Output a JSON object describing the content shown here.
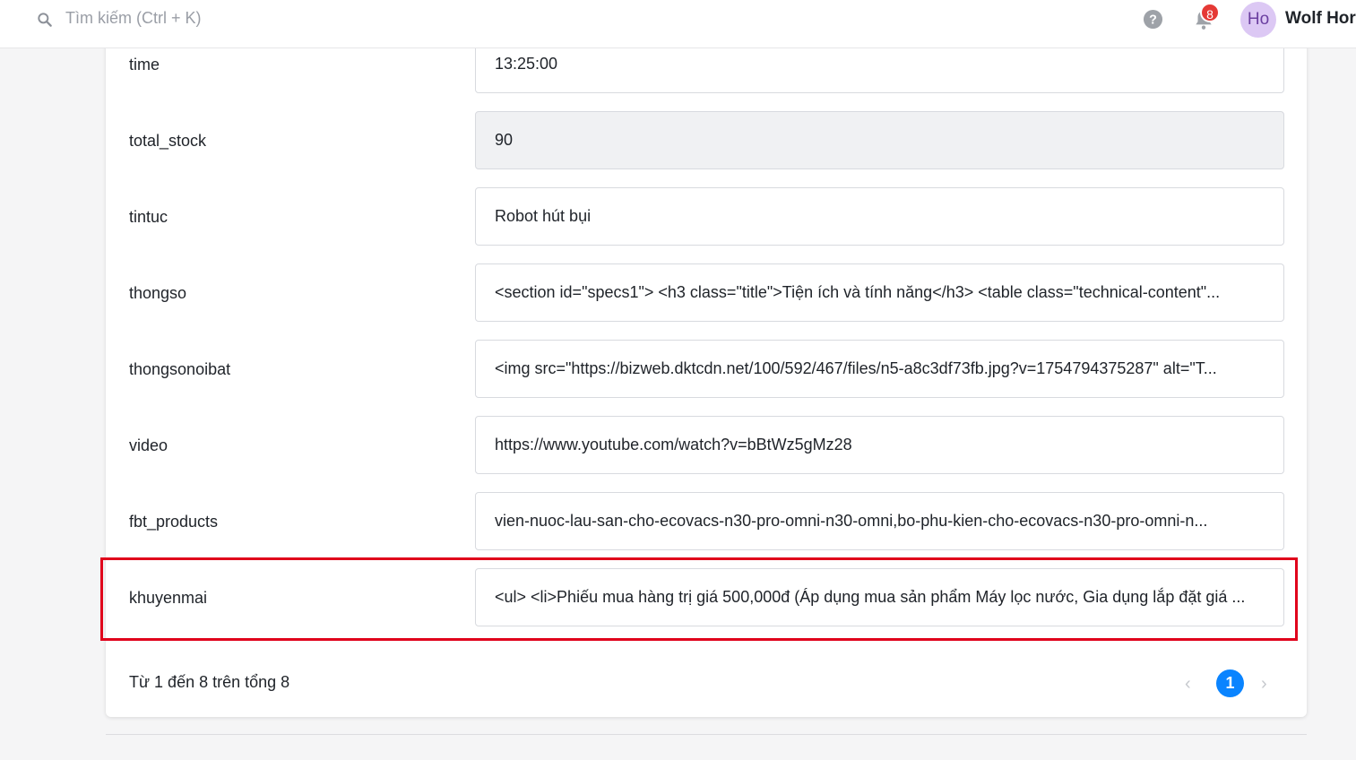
{
  "header": {
    "search_placeholder": "Tìm kiếm (Ctrl + K)",
    "notification_count": "8",
    "avatar_initials": "Ho",
    "user_name": "Wolf Hor"
  },
  "fields": [
    {
      "label": "time",
      "value": "13:25:00",
      "readonly": false
    },
    {
      "label": "total_stock",
      "value": "90",
      "readonly": true
    },
    {
      "label": "tintuc",
      "value": "Robot hút bụi",
      "readonly": false
    },
    {
      "label": "thongso",
      "value": "<section id=\"specs1\"> <h3 class=\"title\">Tiện ích và tính năng</h3> <table class=\"technical-content\"...",
      "readonly": false
    },
    {
      "label": "thongsonoibat",
      "value": "<img src=\"https://bizweb.dktcdn.net/100/592/467/files/n5-a8c3df73fb.jpg?v=1754794375287\" alt=\"T...",
      "readonly": false
    },
    {
      "label": "video",
      "value": "https://www.youtube.com/watch?v=bBtWz5gMz28",
      "readonly": false
    },
    {
      "label": "fbt_products",
      "value": "vien-nuoc-lau-san-cho-ecovacs-n30-pro-omni-n30-omni,bo-phu-kien-cho-ecovacs-n30-pro-omni-n...",
      "readonly": false
    },
    {
      "label": "khuyenmai",
      "value": "<ul> <li>Phiếu mua hàng trị giá 500,000đ (Áp dụng mua sản phẩm Máy lọc nước, Gia dụng lắp đặt giá ...",
      "readonly": false,
      "highlighted": true
    }
  ],
  "pagination": {
    "summary": "Từ 1 đến 8 trên tổng 8",
    "prev": "‹",
    "current_page": "1",
    "next": "›"
  },
  "colors": {
    "highlight": "#e0001b",
    "accent": "#0a84ff",
    "badge": "#e53935"
  }
}
